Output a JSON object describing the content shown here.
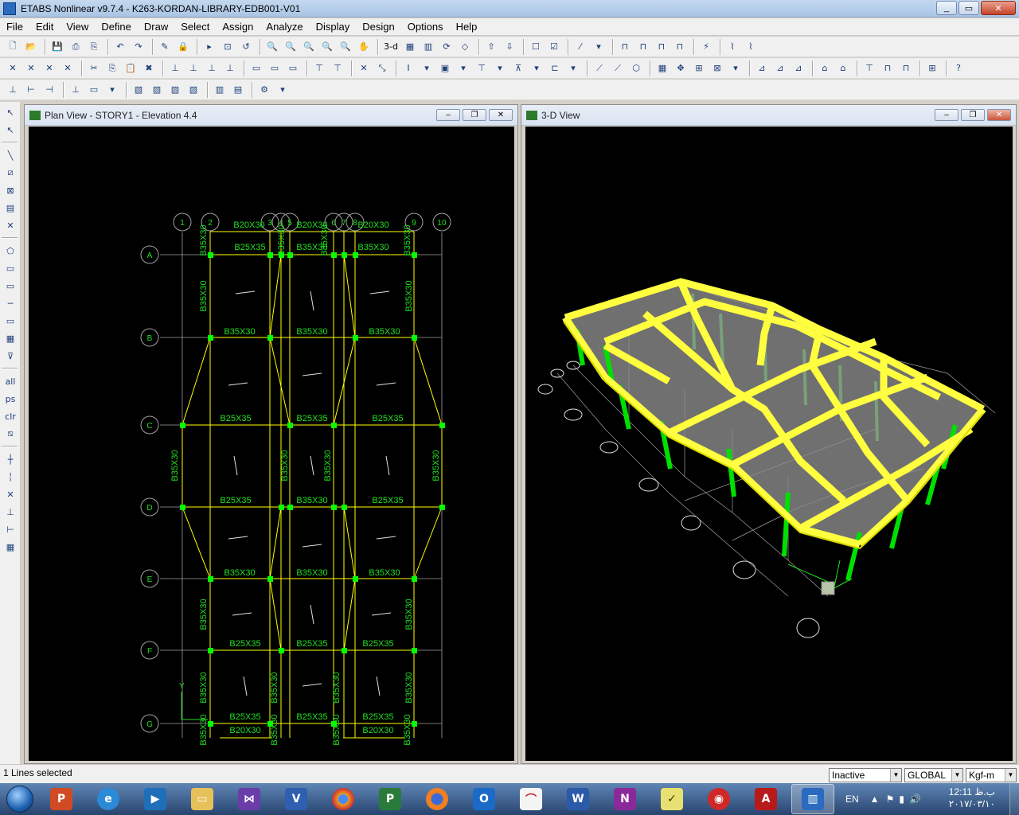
{
  "window": {
    "title": "ETABS Nonlinear v9.7.4 - K263-KORDAN-LIBRARY-EDB001-V01"
  },
  "menu": [
    "File",
    "Edit",
    "View",
    "Define",
    "Draw",
    "Select",
    "Assign",
    "Analyze",
    "Display",
    "Design",
    "Options",
    "Help"
  ],
  "toolbar": {
    "view3d_label": "3-d"
  },
  "plan_view": {
    "title": "Plan View - STORY1 - Elevation 4.4",
    "grid_cols": [
      "1",
      "2",
      "3",
      "4",
      "5",
      "6",
      "7",
      "8",
      "9",
      "10"
    ],
    "grid_rows": [
      "A",
      "B",
      "C",
      "D",
      "E",
      "F",
      "G"
    ],
    "beam_labels": {
      "b20x30": "B20X30",
      "b25x35": "B25X35",
      "b35x30": "B35X30",
      "b35x35": "B35X35"
    },
    "axis_label": "Y"
  },
  "view_3d": {
    "title": "3-D View"
  },
  "status": {
    "text": "1 Lines selected",
    "mode": "Inactive",
    "coord_system": "GLOBAL",
    "units": "Kgf-m"
  },
  "taskbar": {
    "language": "EN",
    "time": "12:11 ب.ظ",
    "date": "۲۰۱۷/۰۳/۱۰"
  },
  "colors": {
    "grid_line": "#a0a0a0",
    "beam_line": "#ffff00",
    "label_green": "#20e020",
    "column_green": "#00ff00",
    "canvas": "#000000"
  }
}
